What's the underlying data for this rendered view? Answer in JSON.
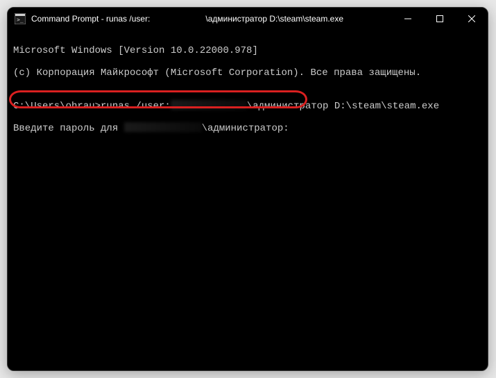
{
  "titlebar": {
    "title_prefix": "Command Prompt - runas  /user:",
    "title_suffix": "\\администратор D:\\steam\\steam.exe"
  },
  "window_controls": {
    "minimize": "minimize",
    "maximize": "maximize",
    "close": "close"
  },
  "terminal": {
    "line1": "Microsoft Windows [Version 10.0.22000.978]",
    "line2": "(c) Корпорация Майкрософт (Microsoft Corporation). Все права защищены.",
    "line3": "",
    "prompt_prefix": "C:\\Users\\ohrau>runas /user:",
    "prompt_suffix": "\\администратор D:\\steam\\steam.exe",
    "password_prefix": "Введите пароль для ",
    "password_suffix": "\\администратор:"
  }
}
